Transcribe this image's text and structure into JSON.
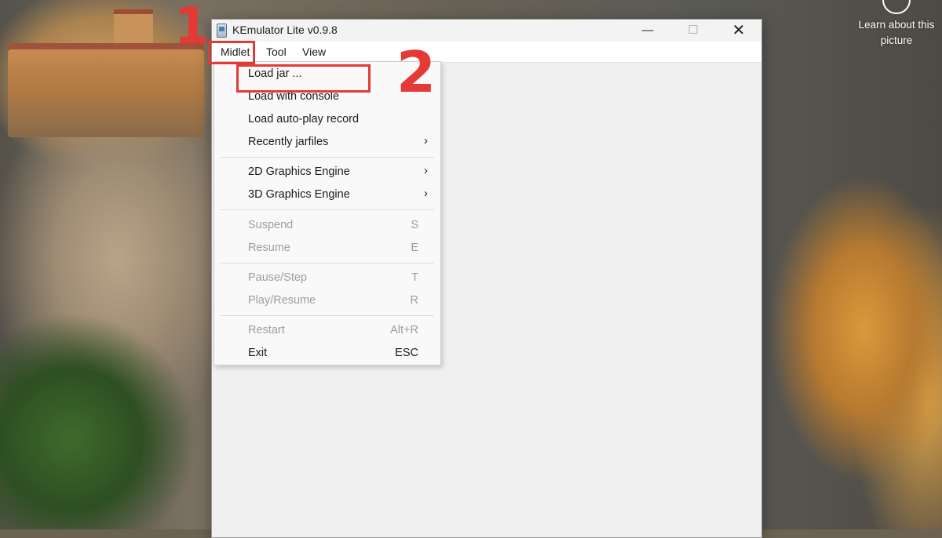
{
  "desktop": {
    "learn_about": "Learn about this picture"
  },
  "window": {
    "title": "KEmulator Lite v0.9.8",
    "controls": {
      "minimize": "—",
      "maximize": "☐",
      "close": "✕"
    }
  },
  "menubar": {
    "items": [
      {
        "label": "Midlet"
      },
      {
        "label": "Tool"
      },
      {
        "label": "View"
      }
    ]
  },
  "dropdown": {
    "items": [
      {
        "label": "Load jar ...",
        "shortcut": "",
        "enabled": true,
        "submenu": false
      },
      {
        "label": "Load with console",
        "shortcut": "",
        "enabled": true,
        "submenu": false
      },
      {
        "label": "Load auto-play record",
        "shortcut": "",
        "enabled": true,
        "submenu": false
      },
      {
        "label": "Recently jarfiles",
        "shortcut": "",
        "enabled": true,
        "submenu": true
      },
      {
        "label": "2D Graphics Engine",
        "shortcut": "",
        "enabled": true,
        "submenu": true
      },
      {
        "label": "3D Graphics Engine",
        "shortcut": "",
        "enabled": true,
        "submenu": true
      },
      {
        "label": "Suspend",
        "shortcut": "S",
        "enabled": false,
        "submenu": false
      },
      {
        "label": "Resume",
        "shortcut": "E",
        "enabled": false,
        "submenu": false
      },
      {
        "label": "Pause/Step",
        "shortcut": "T",
        "enabled": false,
        "submenu": false
      },
      {
        "label": "Play/Resume",
        "shortcut": "R",
        "enabled": false,
        "submenu": false
      },
      {
        "label": "Restart",
        "shortcut": "Alt+R",
        "enabled": false,
        "submenu": false
      },
      {
        "label": "Exit",
        "shortcut": "ESC",
        "enabled": true,
        "submenu": false
      }
    ],
    "submenu_arrow": "›"
  },
  "annotations": {
    "step1": "1",
    "step2": "2",
    "color": "#e53935"
  }
}
